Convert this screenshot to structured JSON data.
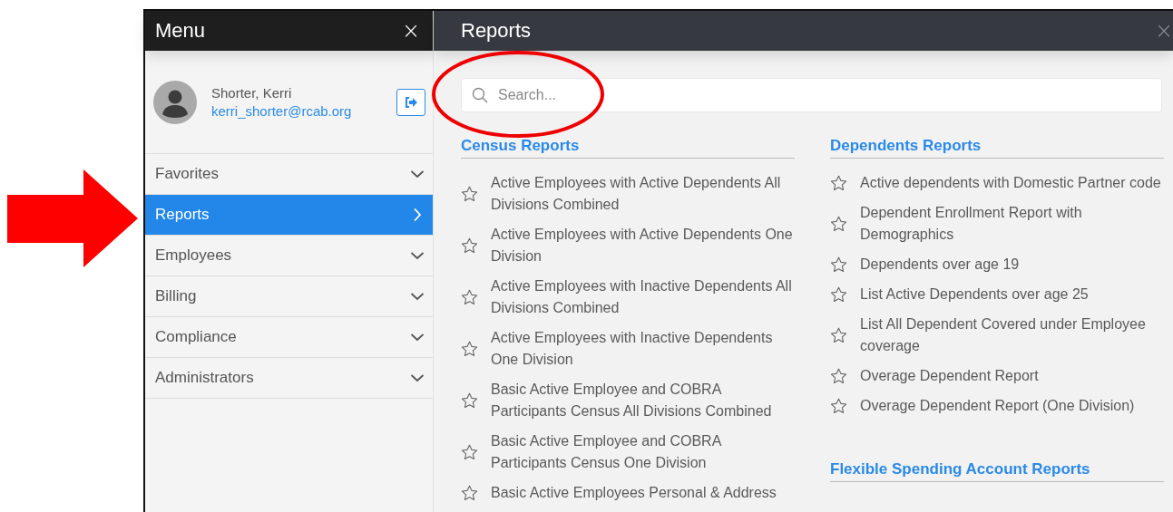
{
  "menu": {
    "title": "Menu",
    "close": "×",
    "user": {
      "name": "Shorter, Kerri",
      "email": "kerri_shorter@rcab.org"
    },
    "items": [
      {
        "label": "Favorites",
        "selected": false
      },
      {
        "label": "Reports",
        "selected": true
      },
      {
        "label": "Employees",
        "selected": false
      },
      {
        "label": "Billing",
        "selected": false
      },
      {
        "label": "Compliance",
        "selected": false
      },
      {
        "label": "Administrators",
        "selected": false
      }
    ]
  },
  "reports": {
    "title": "Reports",
    "close": "×",
    "search": {
      "placeholder": "Search..."
    },
    "columns": [
      {
        "sections": [
          {
            "title": "Census Reports",
            "items": [
              "Active Employees with Active Dependents All Divisions Combined",
              "Active Employees with Active Dependents One Division",
              "Active Employees with Inactive Dependents All Divisions Combined",
              "Active Employees with Inactive Dependents One Division",
              "Basic Active Employee and COBRA Participants Census All Divisions Combined",
              "Basic Active Employee and COBRA Participants Census One Division",
              "Basic Active Employees Personal & Address"
            ]
          }
        ]
      },
      {
        "sections": [
          {
            "title": "Dependents Reports",
            "items": [
              "Active dependents with Domestic Partner code",
              "Dependent Enrollment Report with Demographics",
              "Dependents over age 19",
              "List Active Dependents over age 25",
              "List All Dependent Covered under Employee coverage",
              "Overage Dependent Report",
              "Overage Dependent Report (One Division)"
            ]
          },
          {
            "title": "Flexible Spending Account Reports"
          }
        ]
      }
    ]
  }
}
